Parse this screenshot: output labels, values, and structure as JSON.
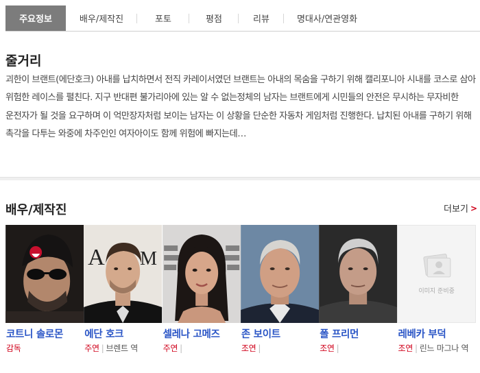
{
  "tabs": [
    {
      "label": "주요정보",
      "active": true
    },
    {
      "label": "배우/제작진",
      "active": false
    },
    {
      "label": "포토",
      "active": false
    },
    {
      "label": "평점",
      "active": false
    },
    {
      "label": "리뷰",
      "active": false
    },
    {
      "label": "명대사/연관영화",
      "active": false
    }
  ],
  "synopsis": {
    "title": "줄거리",
    "text": "괴한이 브랜트(에단호크) 아내를 납치하면서 전직 카레이서였던 브랜트는 아내의 목숨을 구하기 위해 캘리포니아 시내를 코스로 삼아 위험한 레이스를 펼친다. 지구 반대편 불가리아에 있는 알 수 없는정체의 남자는 브랜트에게 시민들의 안전은 무시하는 무자비한 운전자가 될 것을 요구하며 이 억만장자처럼 보이는 남자는 이 상황을 단순한 자동차 게임처럼 진행한다. 납치된 아내를 구하기 위해 촉각을 다투는 와중에 차주인인 여자아이도 함께 위험에 빠지는데…"
  },
  "cast": {
    "title": "배우/제작진",
    "more_label": "더보기",
    "members": [
      {
        "name": "코트니 솔로몬",
        "role": "감독",
        "character": ""
      },
      {
        "name": "에단 호크",
        "role": "주연",
        "character": "브렌트 역"
      },
      {
        "name": "셀레나 고메즈",
        "role": "주연",
        "character": ""
      },
      {
        "name": "존 보이트",
        "role": "조연",
        "character": ""
      },
      {
        "name": "폴 프리먼",
        "role": "조연",
        "character": ""
      },
      {
        "name": "레베카 부덕",
        "role": "조연",
        "character": "린느 마그나 역"
      }
    ],
    "no_image_label": "이미지 준비중"
  }
}
